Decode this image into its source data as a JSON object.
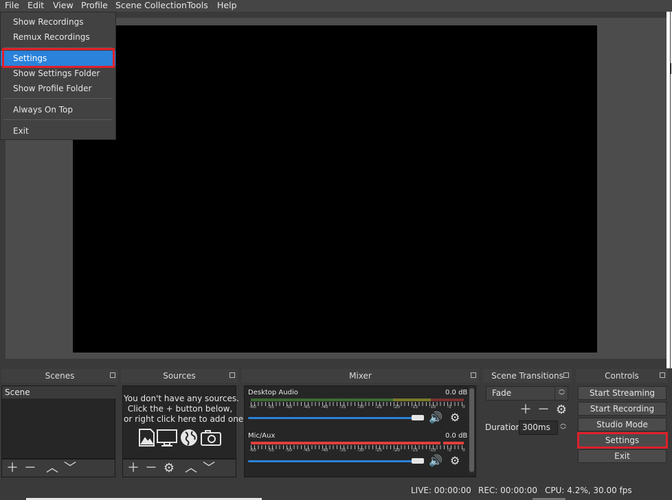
{
  "menubar": [
    "File",
    "Edit",
    "View",
    "Profile",
    "Scene Collection",
    "Tools",
    "Help"
  ],
  "file_menu": {
    "items": [
      "Show Recordings",
      "Remux Recordings",
      "Settings",
      "Show Settings Folder",
      "Show Profile Folder",
      "Always On Top",
      "Exit"
    ],
    "highlighted": "Settings"
  },
  "docks": {
    "scenes": {
      "title": "Scenes",
      "items": [
        "Scene"
      ]
    },
    "sources": {
      "title": "Sources",
      "empty_message": [
        "You don't have any sources.",
        "Click the + button below,",
        "or right click here to add one."
      ]
    },
    "mixer": {
      "title": "Mixer",
      "channels": [
        {
          "name": "Desktop Audio",
          "db": "0.0 dB"
        },
        {
          "name": "Mic/Aux",
          "db": "0.0 dB"
        }
      ],
      "tick_labels": [
        "-60",
        "-55",
        "-50",
        "-45",
        "-40",
        "-35",
        "-30",
        "-25",
        "-20",
        "-15",
        "-10",
        "-5",
        "0"
      ]
    },
    "transitions": {
      "title": "Scene Transitions",
      "type": "Fade",
      "duration_label": "Duration",
      "duration_value": "300ms"
    },
    "controls": {
      "title": "Controls",
      "buttons": [
        "Start Streaming",
        "Start Recording",
        "Studio Mode",
        "Settings",
        "Exit"
      ]
    }
  },
  "status": {
    "live": "LIVE: 00:00:00",
    "rec": "REC: 00:00:00",
    "cpu": "CPU: 4.2%, 30.00 fps"
  },
  "colors": {
    "highlight": "#2a82da",
    "annotation": "#e0202a",
    "background": "#3a3a3a"
  }
}
